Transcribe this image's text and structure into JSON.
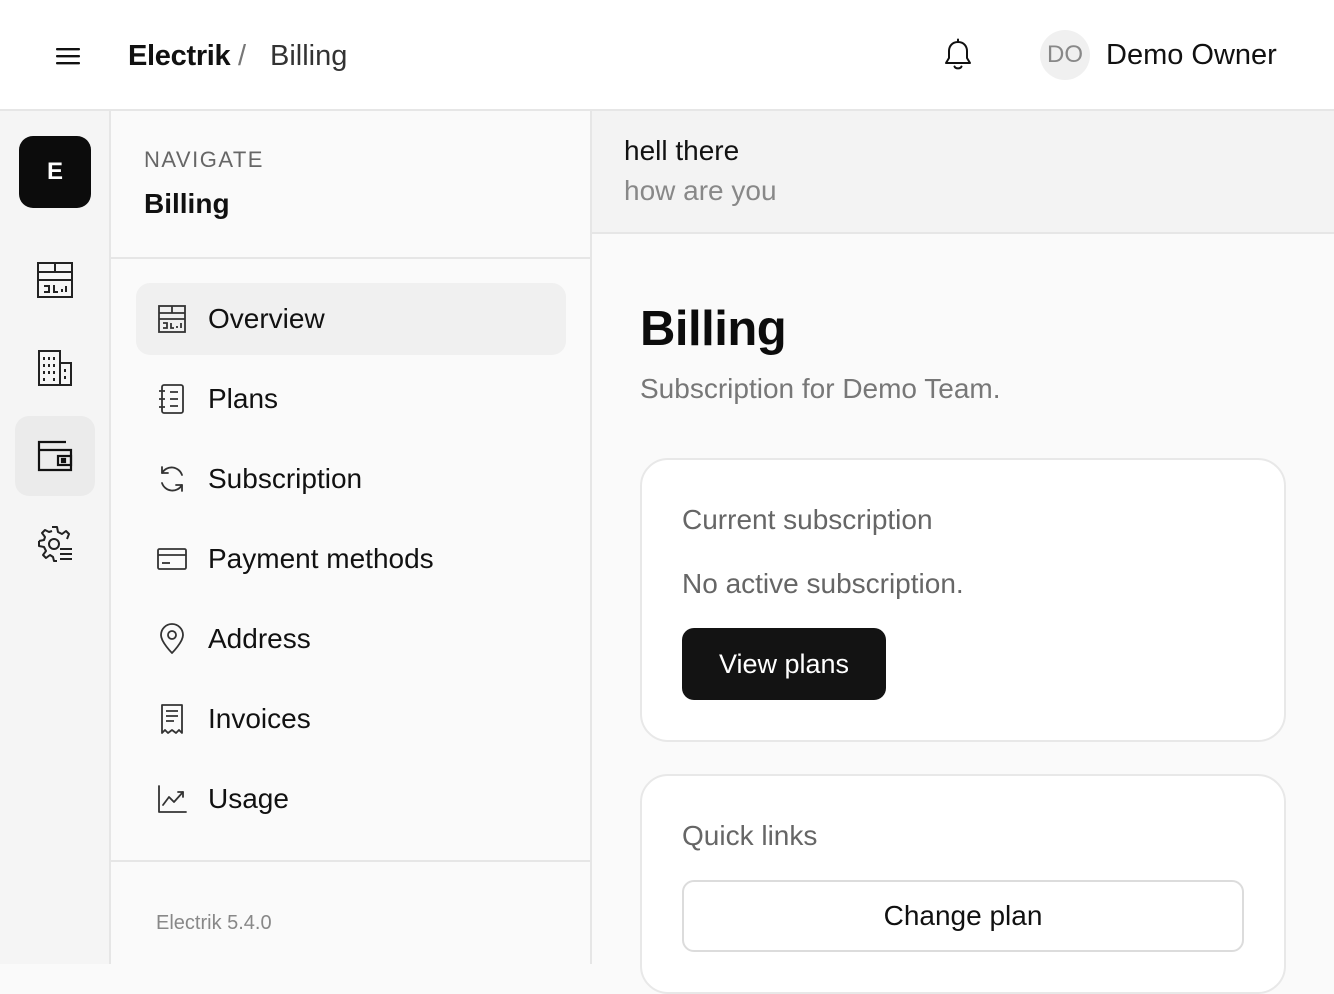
{
  "header": {
    "app_name": "Electrik",
    "separator": "/",
    "page": "Billing",
    "user": {
      "initials": "DO",
      "name": "Demo Owner"
    },
    "icons": {
      "menu": "menu-icon",
      "notifications": "bell-icon"
    }
  },
  "rail": {
    "logo_letter": "E",
    "items": [
      {
        "icon": "dashboard-icon",
        "active": false
      },
      {
        "icon": "building-icon",
        "active": false
      },
      {
        "icon": "wallet-icon",
        "active": true
      },
      {
        "icon": "settings-icon",
        "active": false
      }
    ]
  },
  "nav": {
    "kicker": "NAVIGATE",
    "title": "Billing",
    "items": [
      {
        "label": "Overview",
        "icon": "dashboard-icon",
        "active": true
      },
      {
        "label": "Plans",
        "icon": "notebook-icon",
        "active": false
      },
      {
        "label": "Subscription",
        "icon": "refresh-icon",
        "active": false
      },
      {
        "label": "Payment methods",
        "icon": "credit-card-icon",
        "active": false
      },
      {
        "label": "Address",
        "icon": "map-pin-icon",
        "active": false
      },
      {
        "label": "Invoices",
        "icon": "receipt-icon",
        "active": false
      },
      {
        "label": "Usage",
        "icon": "chart-line-icon",
        "active": false
      }
    ],
    "version": "Electrik 5.4.0"
  },
  "banner": {
    "title": "hell there",
    "subtitle": "how are you"
  },
  "main": {
    "title": "Billing",
    "subtitle": "Subscription for Demo Team.",
    "current_subscription": {
      "title": "Current subscription",
      "status": "No active subscription.",
      "button": "View plans"
    },
    "quick_links": {
      "title": "Quick links",
      "buttons": [
        "Change plan"
      ]
    }
  },
  "colors": {
    "accent_dark": "#131313",
    "header_bg": "#ffffff",
    "page_bg": "#fafafa",
    "border": "#e6e6e6",
    "muted_text": "#777777"
  }
}
